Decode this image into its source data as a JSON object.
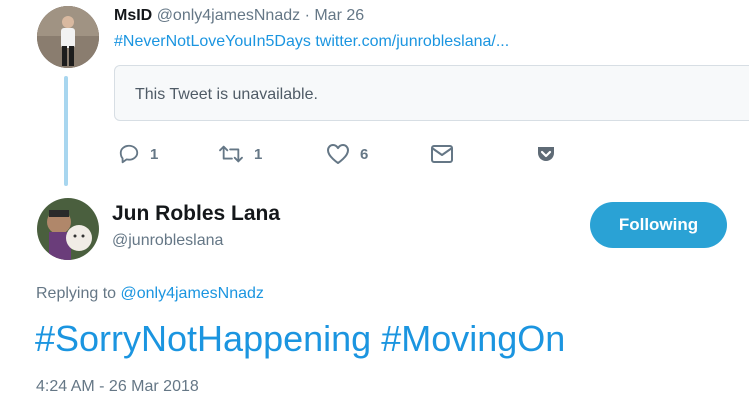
{
  "reply_tweet": {
    "author_name": "MsID",
    "author_handle": "@only4jamesNnadz",
    "separator": "·",
    "date": "Mar 26",
    "hashtag": "#NeverNotLoveYouIn5Days",
    "link_text": "twitter.com/junrobleslana/...",
    "quoted_card_text": "This Tweet is unavailable.",
    "actions": {
      "reply_count": "1",
      "retweet_count": "1",
      "like_count": "6"
    }
  },
  "main_tweet": {
    "author_name": "Jun Robles Lana",
    "author_handle": "@junrobleslana",
    "follow_button_label": "Following",
    "replying_to_label": "Replying to",
    "replying_to_handle": "@only4jamesNnadz",
    "text": "#SorryNotHappening #MovingOn",
    "timestamp": "4:24 AM - 26 Mar 2018"
  },
  "colors": {
    "link": "#1b95e0",
    "follow_button": "#2aa2d5",
    "thread_line": "#a8d6ef",
    "muted": "#657786"
  },
  "icons": [
    "reply-icon",
    "retweet-icon",
    "heart-icon",
    "message-icon",
    "pocket-icon"
  ]
}
